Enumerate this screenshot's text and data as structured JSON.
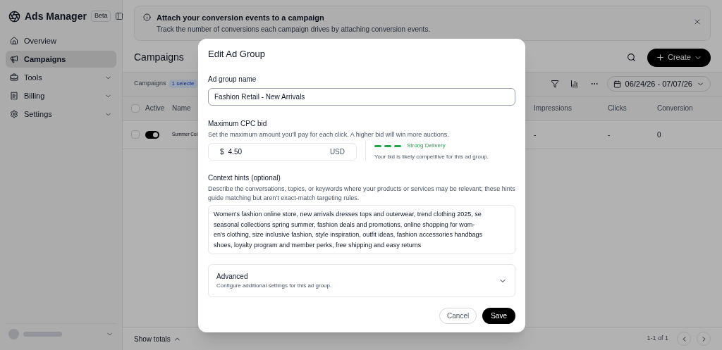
{
  "sidebar": {
    "brand": "Ads Manager",
    "badge": "Beta",
    "items": [
      {
        "label": "Overview",
        "selected": false,
        "expandable": false
      },
      {
        "label": "Campaigns",
        "selected": true,
        "expandable": false
      },
      {
        "label": "Tools",
        "selected": false,
        "expandable": true
      },
      {
        "label": "Billing",
        "selected": false,
        "expandable": true
      },
      {
        "label": "Settings",
        "selected": false,
        "expandable": true
      }
    ]
  },
  "banner": {
    "title": "Attach your conversion events to a campaign",
    "text": "Track the number of conversions each campaign drives by attaching conversion events."
  },
  "header": {
    "title": "Campaigns",
    "create": "Create"
  },
  "toolbar": {
    "label": "Campaigns",
    "selection": "1 selecte",
    "date_range": "06/24/26 - 07/07/26"
  },
  "table": {
    "all_checked": false,
    "columns": [
      "Active",
      "Name",
      "Impressions",
      "Clicks",
      "Conversion"
    ],
    "rows": [
      {
        "checked": false,
        "on": true,
        "name": "Summer Col",
        "impressions": "-",
        "clicks": "-",
        "conversions": "0"
      }
    ]
  },
  "footer": {
    "totals": "Show totals",
    "pagination": "1-1 of 1"
  },
  "dialog": {
    "title": "Edit Ad Group",
    "name_label": "Ad group name",
    "name_value": "Fashion Retail - New Arrivals",
    "bid_label": "Maximum CPC bid",
    "bid_help": "Set the maximum amount you'll pay for each click. A higher bid will win more auctions.",
    "currency_symbol": "$",
    "bid_value": "4.50",
    "currency": "USD",
    "delivery": "Strong Delivery",
    "delivery_note": "Your bid is likely competitive for this ad group.",
    "hints_label": "Context hints (optional)",
    "hints_help": "Describe the conversations, topics, or keywords where your products or services may be relevant; these hints guide matching but aren't exact-match targeting rules.",
    "hints_lines": [
      "Women's fashion online store, new arrivals dresses tops and outerwear, trend clothing 2025, se",
      "seasonal collections spring summer, fashion deals and promotions, online shopping for wom-",
      "en's clothing, size inclusive fashion, style inspiration, outfit ideas, fashion accessories handbags",
      "shoes, loyalty program and member perks, free shipping and easy returns"
    ],
    "advanced": {
      "title": "Advanced",
      "text": "Configure additional settings for this ad group.",
      "expanded": false
    },
    "cancel": "Cancel",
    "save": "Save"
  }
}
